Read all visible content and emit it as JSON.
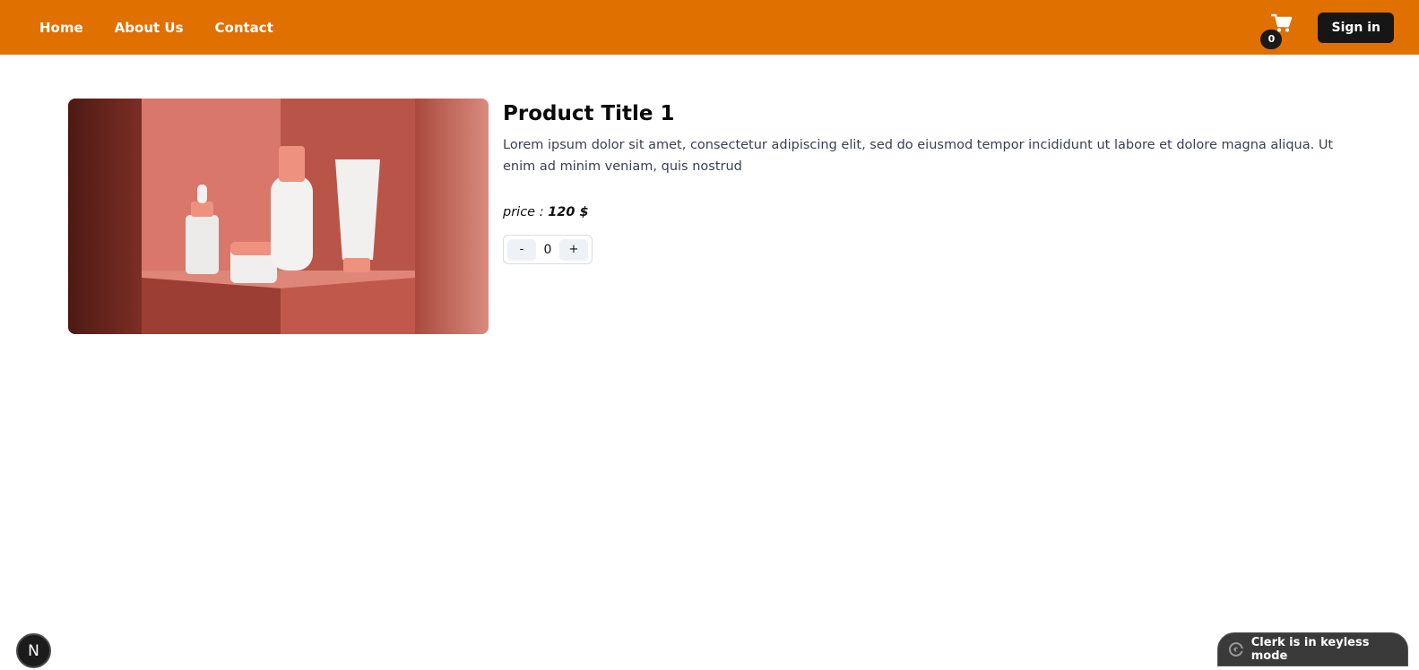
{
  "nav": {
    "links": [
      "Home",
      "About Us",
      "Contact"
    ],
    "cart_count": "0",
    "signin_label": "Sign in"
  },
  "product": {
    "title": "Product Title 1",
    "description": "Lorem ipsum dolor sit amet, consectetur adipiscing elit, sed do eiusmod tempor incididunt ut labore et dolore magna aliqua. Ut enim ad minim veniam, quis nostrud",
    "price_label": "price :",
    "price_value": "120 $",
    "quantity": "0",
    "decrement_label": "-",
    "increment_label": "+",
    "image_icon": "cosmetics-product-photo"
  },
  "widgets": {
    "next_badge": "N",
    "clerk_text": "Clerk is in keyless mode"
  },
  "colors": {
    "header_bg": "#e07000",
    "button_dark": "#161616",
    "text_body": "#384152"
  }
}
